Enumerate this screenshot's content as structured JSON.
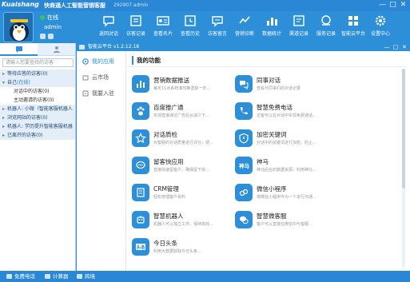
{
  "titlebar": {
    "brand": "Kuaishang",
    "app_title": "快商通人工智能营销客服",
    "sub": "292907  admin",
    "controls": [
      "—",
      "□",
      "✕"
    ]
  },
  "user": {
    "status": "在线",
    "name": "admin"
  },
  "toolbar": [
    {
      "label": "返回对话",
      "icon": "back-chat-icon"
    },
    {
      "label": "访客记录",
      "icon": "visitor-record-icon"
    },
    {
      "label": "查看名片",
      "icon": "view-card-icon"
    },
    {
      "label": "查看历史",
      "icon": "history-icon"
    },
    {
      "label": "访客留言",
      "icon": "message-icon"
    },
    {
      "label": "营销诊断",
      "icon": "diagnosis-icon"
    },
    {
      "label": "数据统计",
      "icon": "statistics-icon"
    },
    {
      "label": "渠道记录",
      "icon": "channel-record-icon"
    },
    {
      "label": "服务记录",
      "icon": "service-record-icon"
    },
    {
      "label": "智能云平台",
      "icon": "cloud-platform-icon"
    },
    {
      "label": "设置中心",
      "icon": "settings-icon"
    }
  ],
  "left": {
    "tabs": [
      "chat-tab",
      "contacts-tab"
    ],
    "search_placeholder": "请输入您要查找的访客",
    "tree": [
      {
        "text": "等待应答的访客(0)",
        "kind": "group",
        "arrow": "▸"
      },
      {
        "text": "自己",
        "extra": "(在线)",
        "kind": "group",
        "arrow": "▾"
      },
      {
        "text": "对话中的访客(0)",
        "kind": "sub"
      },
      {
        "text": "主动邀请的访客(0)",
        "kind": "sub"
      },
      {
        "text": "机器人: 小微（智能客服机器人",
        "kind": "group",
        "arrow": "▸"
      },
      {
        "text": "浏览网站的访客(0)",
        "kind": "group",
        "arrow": "▸"
      },
      {
        "text": "机器人: 学历提升智能客服机器",
        "kind": "group",
        "arrow": "▸"
      },
      {
        "text": "已离开的访客(0)",
        "kind": "group",
        "arrow": "▸"
      }
    ]
  },
  "plugin": {
    "title": "智能云平台 v1.2.12.18",
    "nav": [
      {
        "label": "我的应用",
        "icon": "apps-icon"
      },
      {
        "label": "云市场",
        "icon": "market-icon"
      },
      {
        "label": "我要入驻",
        "icon": "settle-icon"
      }
    ],
    "section": "我的功能",
    "apps": [
      {
        "name": "营销数据推送",
        "desc": "每天11点系统准时推送前一天...",
        "icon": "bar-chart-icon"
      },
      {
        "name": "同事对话",
        "desc": "查看与同事们的对话记录",
        "icon": "colleague-chat-icon"
      },
      {
        "name": "百度推广通",
        "desc": "实现直接通过广告后台减少下...",
        "icon": "baidu-paw-icon"
      },
      {
        "name": "智慧免费电话",
        "desc": "访客可以在对话中实现免费通话...",
        "icon": "phone-icon"
      },
      {
        "name": "对话质检",
        "desc": "对客服的对话质量进行评分，便...",
        "icon": "star-icon"
      },
      {
        "name": "加密关键词",
        "desc": "对话中的关键词进行加密，防止...",
        "icon": "shield-icon"
      },
      {
        "name": "留客快应用",
        "desc": "直接快速留客户，确保留下快...",
        "icon": "chat-bubble-icon"
      },
      {
        "name": "神马",
        "desc": "神马后台的数据资源，利用神马...",
        "icon": "shenma-icon"
      },
      {
        "name": "CRM管理",
        "desc": "轻松管理客户资料",
        "icon": "crm-icon"
      },
      {
        "name": "微信小程序",
        "desc": "将微信小程序作为一个进行沟通...",
        "icon": "miniprogram-icon"
      },
      {
        "name": "智慧机器人",
        "desc": "机器人可以独立工作，保持高效...",
        "icon": "robot-icon"
      },
      {
        "name": "智慧微客服",
        "desc": "客户可以直接在微信中与客服...",
        "icon": "wechat-service-icon"
      },
      {
        "name": "今日头条",
        "desc": "利用大数据获取今日头条...",
        "icon": "toutiao-icon"
      }
    ]
  },
  "bottom": [
    {
      "label": "免费电话",
      "icon": "free-phone-icon"
    },
    {
      "label": "计算器",
      "icon": "calculator-icon"
    },
    {
      "label": "跨境",
      "icon": "crossborder-icon"
    }
  ]
}
